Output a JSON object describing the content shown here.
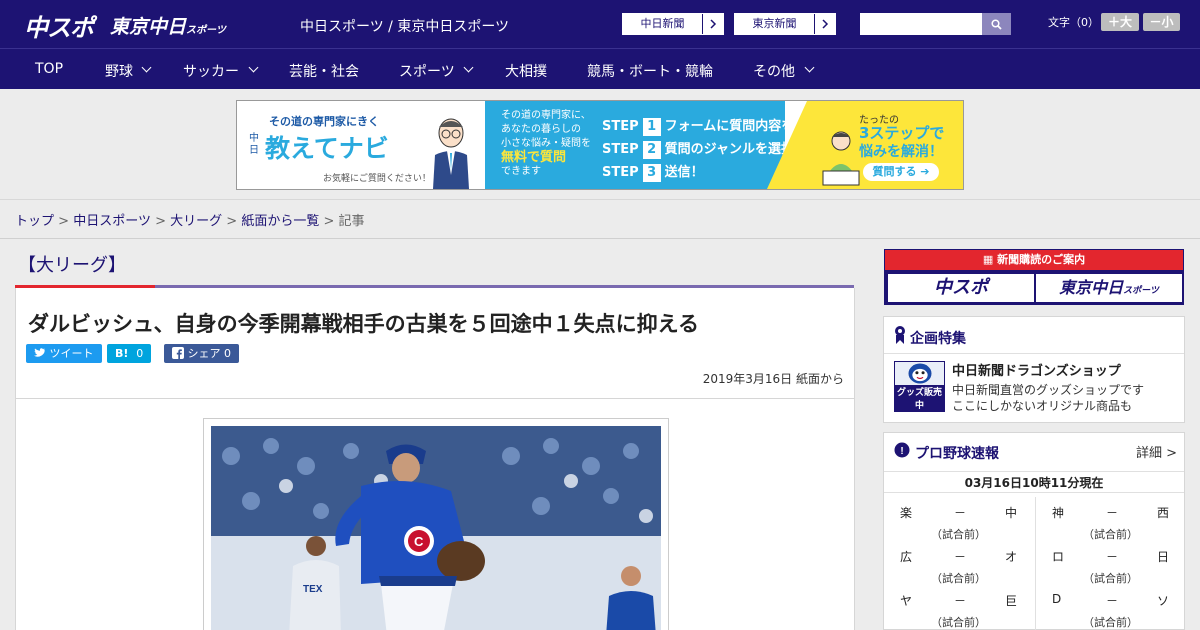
{
  "header": {
    "logo_chuspo": "中スポ",
    "logo_tokyo": "東京中日",
    "logo_tokyo_small": "スポーツ",
    "site_title": "中日スポーツ / 東京中日スポーツ",
    "link_chunichi": "中日新聞",
    "link_tokyo": "東京新聞",
    "search_placeholder": "",
    "font_label": "文字（0）",
    "font_bigger": "＋大",
    "font_smaller": "－小"
  },
  "nav": {
    "items": [
      "TOP",
      "野球",
      "サッカー",
      "芸能・社会",
      "スポーツ",
      "大相撲",
      "競馬・ボート・競輪",
      "その他"
    ]
  },
  "banner": {
    "tagline": "その道の専門家にきく",
    "prefix": "中日",
    "brand": "教えてナビ",
    "note": "お気軽にご質問ください！",
    "mid1": "その道の専門家に、",
    "mid2": "あなたの暮らしの",
    "mid3": "小さな悩み・疑問を",
    "mid4": "無料で質問",
    "mid5": "できます",
    "step_word": "STEP",
    "step1": "フォームに質問内容を入力",
    "step2": "質問のジャンルを選択",
    "step3": "送信！",
    "r1": "たったの",
    "r2": "3ステップで",
    "r3": "悩みを解消！",
    "cta": "質問する"
  },
  "breadcrumb": {
    "items": [
      "トップ",
      "中日スポーツ",
      "大リーグ",
      "紙面から一覧"
    ],
    "current": "記事",
    "sep": ">"
  },
  "article": {
    "category": "【大リーグ】",
    "headline": "ダルビッシュ、自身の今季開幕戦相手の古巣を５回途中１失点に抑える",
    "tweet_label": "ツイート",
    "hatena_label": "B!",
    "hatena_count": "0",
    "fb_label": "シェア",
    "fb_count": "0",
    "date": "2019年3月16日 紙面から"
  },
  "sidebar": {
    "subscribe_title": "新聞購読のご案内",
    "sub_logo1": "中スポ",
    "sub_logo2": "東京中日",
    "sub_logo2_small": "スポーツ",
    "feature_title": "企画特集",
    "shop_name": "中日新聞ドラゴンズショップ",
    "shop_desc1": "中日新聞直営のグッズショップです",
    "shop_desc2": "ここにしかないオリジナル商品も",
    "shop_badge": "グッズ販売中",
    "live_title": "プロ野球速報",
    "live_more": "詳細 >",
    "live_time": "03月16日10時11分現在",
    "games": [
      {
        "home": "楽",
        "away": "中",
        "status": "（試合前）"
      },
      {
        "home": "神",
        "away": "西",
        "status": "（試合前）"
      },
      {
        "home": "広",
        "away": "オ",
        "status": "（試合前）"
      },
      {
        "home": "ロ",
        "away": "日",
        "status": "（試合前）"
      },
      {
        "home": "ヤ",
        "away": "巨",
        "status": "（試合前）"
      },
      {
        "home": "D",
        "away": "ソ",
        "status": "（試合前）"
      }
    ],
    "dash": "－"
  },
  "colors": {
    "brand_navy": "#1d1373",
    "accent_red": "#e3262e",
    "twitter": "#1d9bf0",
    "hatena": "#00a4de",
    "facebook": "#3b5998"
  }
}
